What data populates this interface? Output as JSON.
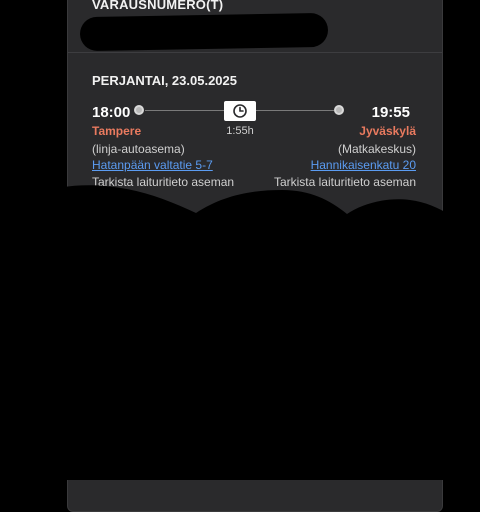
{
  "booking": {
    "reservation_label": "VARAUSNUMERO(T)"
  },
  "trip": {
    "date": "PERJANTAI, 23.05.2025",
    "duration": "1:55h",
    "departure": {
      "time": "18:00",
      "city": "Tampere",
      "station": "(linja-autoasema)",
      "address": "Hatanpään valtatie 5-7",
      "platform_note": "Tarkista laituritieto aseman"
    },
    "arrival": {
      "time": "19:55",
      "city": "Jyväskylä",
      "station": "(Matkakeskus)",
      "address": "Hannikaisenkatu 20",
      "platform_note": "Tarkista laituritieto aseman"
    }
  },
  "icons": {
    "clock": "clock-icon",
    "stop": "stop-dot-icon"
  },
  "colors": {
    "background": "#000000",
    "card": "#2a2a2c",
    "city_accent": "#e97a5f",
    "link": "#5b9cf2",
    "text_primary": "#ffffff",
    "text_secondary": "#cfcfcf"
  }
}
